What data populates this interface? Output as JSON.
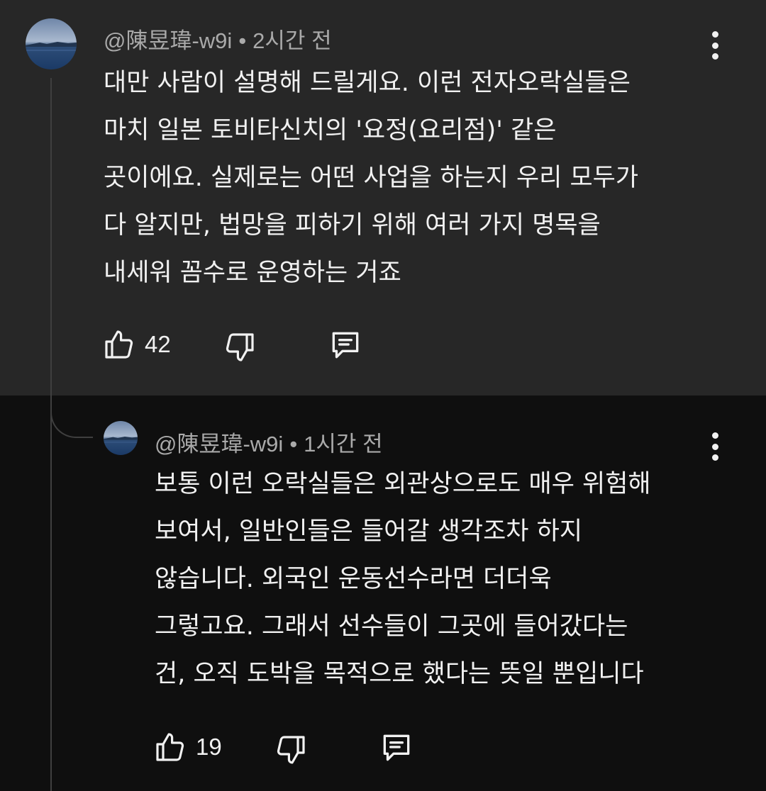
{
  "comments": [
    {
      "author": "@陳昱瑋-w9i",
      "separator": "•",
      "time": "2시간 전",
      "lines": [
        "대만 사람이 설명해 드릴게요. 이런 전자오락실들은",
        "마치 일본 토비타신치의 '요정(요리점)' 같은",
        "곳이에요. 실제로는 어떤 사업을 하는지 우리 모두가",
        "다 알지만, 법망을 피하기 위해 여러 가지 명목을",
        "내세워 꼼수로 운영하는 거죠"
      ],
      "like_count": "42",
      "avatar_icon": "lake-avatar-icon",
      "colors": {
        "background": "#272727"
      }
    },
    {
      "author": "@陳昱瑋-w9i",
      "separator": "•",
      "time": "1시간 전",
      "lines": [
        "보통 이런 오락실들은 외관상으로도 매우 위험해",
        "보여서, 일반인들은 들어갈 생각조차 하지",
        "않습니다. 외국인 운동선수라면 더더욱",
        "그렇고요. 그래서 선수들이 그곳에 들어갔다는",
        "건, 오직 도박을 목적으로 했다는 뜻일 뿐입니다"
      ],
      "like_count": "19",
      "avatar_icon": "lake-avatar-icon",
      "colors": {
        "background": "#0f0f0f"
      }
    }
  ],
  "icons": {
    "like": "thumbs-up-icon",
    "dislike": "thumbs-down-icon",
    "reply": "reply-comment-icon",
    "more": "more-vertical-icon"
  },
  "colors": {
    "text": "#f1f1f1",
    "meta": "#aaaaaa",
    "thread_line": "#3f3f3f"
  }
}
